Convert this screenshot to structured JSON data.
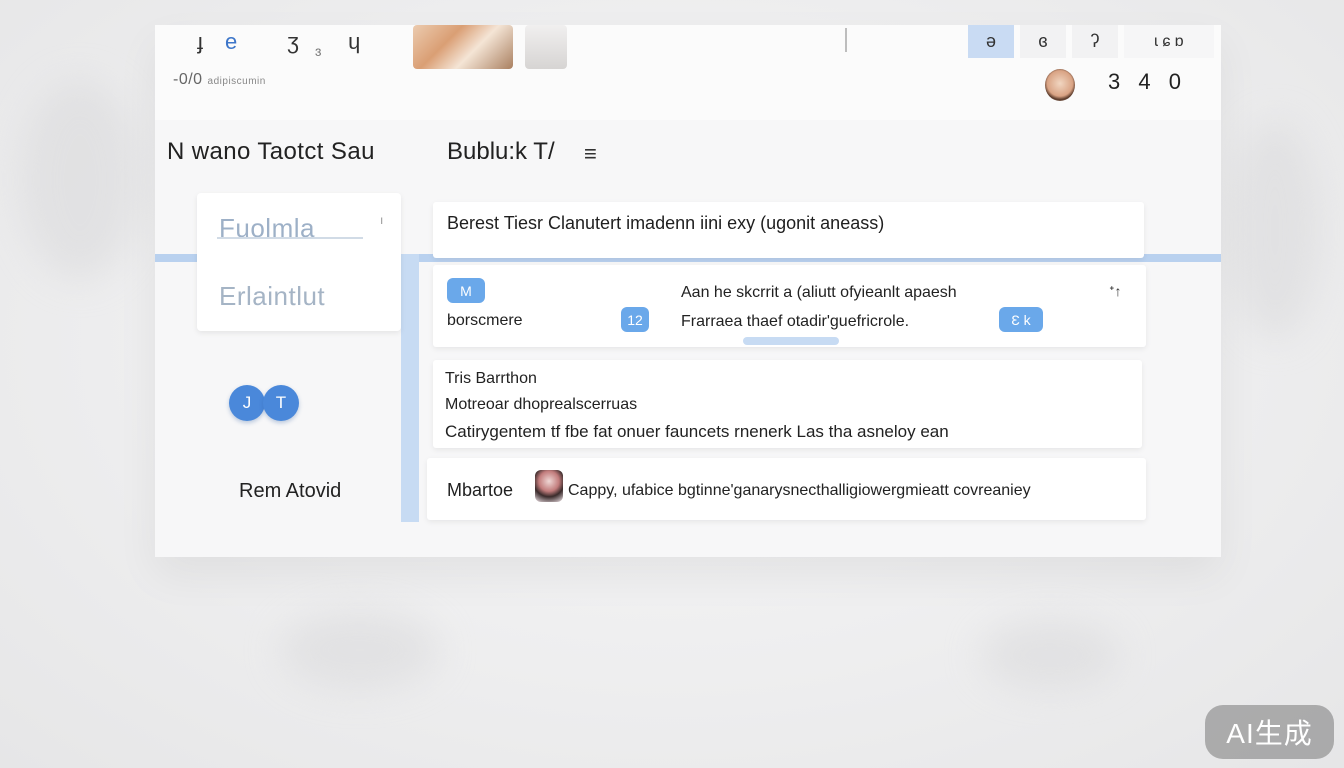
{
  "toolbar": {
    "glyphs_left": [
      "ɟ",
      "e",
      "ʒ",
      "ɥ"
    ],
    "glyph_small": "ɜ",
    "subtitle": "-0/0",
    "subtitle_small": "adipiscumin",
    "right_buttons": [
      "ə",
      "ɞ",
      "ʔ"
    ],
    "right_trail": "ɩ ɕ ɒ",
    "counter": "3 4 0"
  },
  "header": {
    "title": "N wano Taotct Sau",
    "section_title": "Bublu:k T/",
    "menu_icon": "≡"
  },
  "left_panel": {
    "items": [
      "Fuolmla",
      "Erlaintlut"
    ],
    "caret": "ı",
    "badges": [
      "J",
      "T"
    ],
    "footer_text": "Rem Atovid"
  },
  "content": {
    "header_card": "Berest Tiesr  Clanutert imadenn iini exy (ugonit aneass)",
    "detail": {
      "badge_a": "M",
      "badge_b": "12",
      "badge_c": "Ɛ k",
      "label": "borscmere",
      "line_1": "Aan he skcrrit a (aliutt ofyieanlt apaesh",
      "line_2": "Frarraea thaef otadir'guefricrole.",
      "icon": "ᐩ↑"
    },
    "list": [
      "Tris Barrthon",
      "Motreoar dhoprealscerruas",
      "Catirygentem tf fbe fat onuer fauncets rnenerk Las tha asneloy ean"
    ],
    "footer": {
      "label": "Mbartoe",
      "text": "Cappy, ufabice bgtinne'ganarysnecthalligiowergmieatt covreaniey"
    }
  },
  "watermark": "AI生成"
}
